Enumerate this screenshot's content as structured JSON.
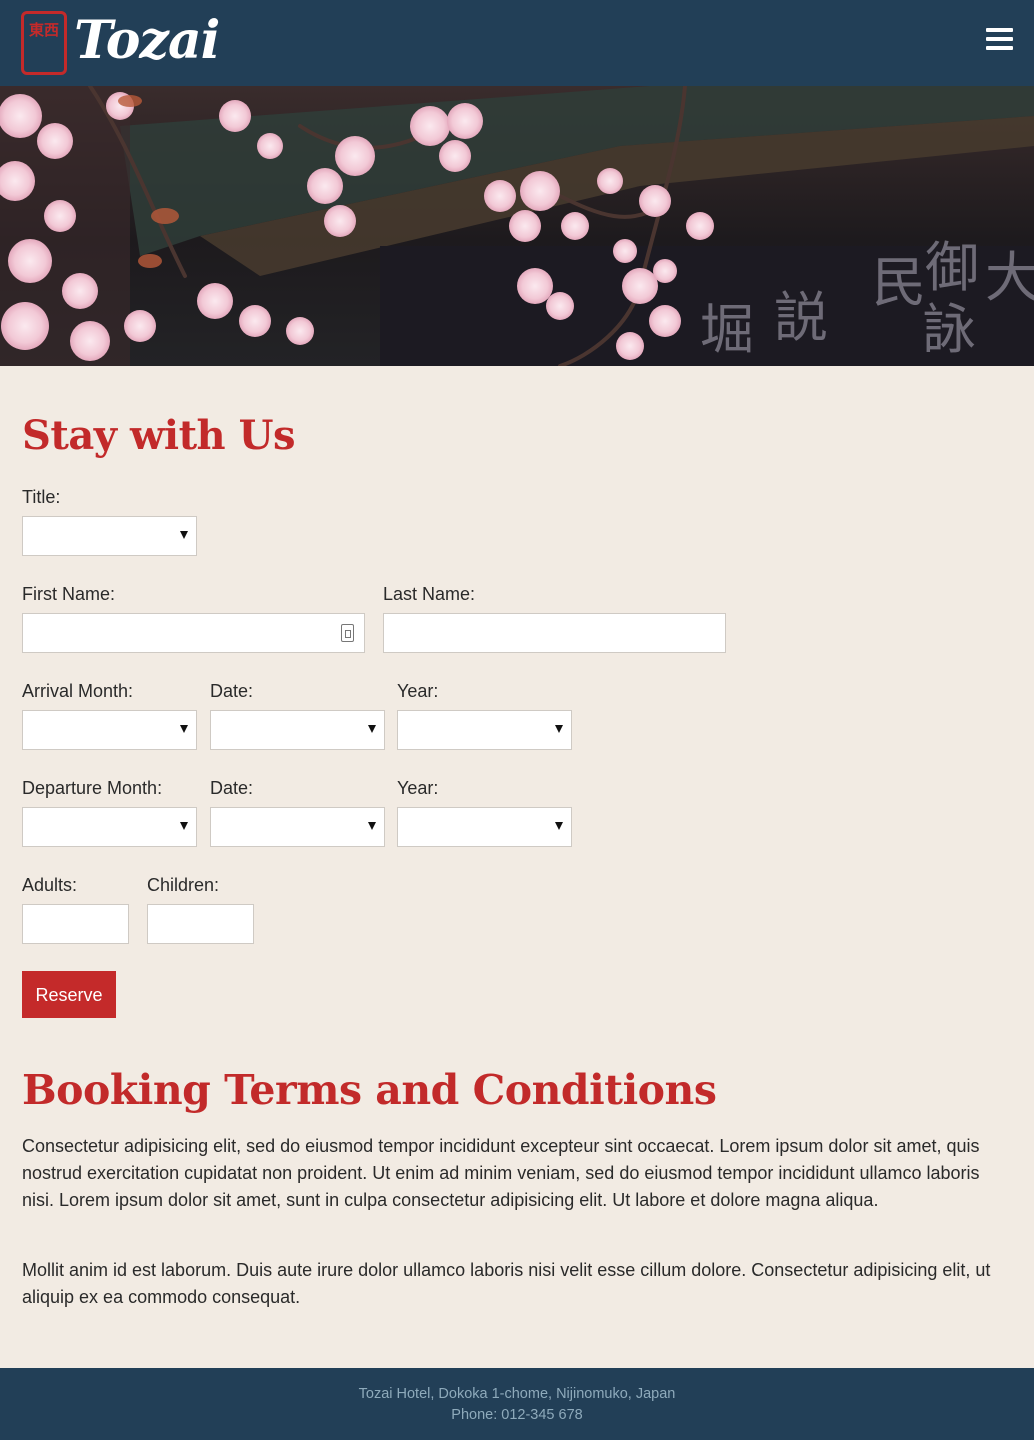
{
  "header": {
    "logo_seal_text": "東西",
    "logo_text": "Tozai",
    "menu_icon": "hamburger-icon"
  },
  "hero": {
    "image": "cherry blossoms"
  },
  "form": {
    "title": "Stay with Us",
    "title_label": "Title:",
    "first_name_label": "First Name:",
    "last_name_label": "Last Name:",
    "arrival_month_label": "Arrival Month:",
    "arrival_date_label": "Date:",
    "arrival_year_label": "Year:",
    "departure_month_label": "Departure Month:",
    "departure_date_label": "Date:",
    "departure_year_label": "Year:",
    "adults_label": "Adults:",
    "children_label": "Children:",
    "reserve_label": "Reserve"
  },
  "terms": {
    "heading": "Booking Terms and Conditions",
    "paragraphs": [
      "Consectetur adipisicing elit, sed do eiusmod tempor incididunt excepteur sint occaecat. Lorem ipsum dolor sit amet, quis nostrud exercitation cupidatat non proident. Ut enim ad minim veniam, sed do eiusmod tempor incididunt ullamco laboris nisi. Lorem ipsum dolor sit amet, sunt in culpa consectetur adipisicing elit. Ut labore et dolore magna aliqua.",
      "Mollit anim id est laborum. Duis aute irure dolor ullamco laboris nisi velit esse cillum dolore. Consectetur adipisicing elit, ut aliquip ex ea commodo consequat."
    ]
  },
  "footer": {
    "address": "Tozai Hotel, Dokoka 1-chome, Nijinomuko, Japan",
    "phone": "Phone: 012-345 678"
  },
  "colors": {
    "header_bg": "#223f57",
    "accent": "#c42a2a",
    "page_bg": "#f2ebe3"
  }
}
